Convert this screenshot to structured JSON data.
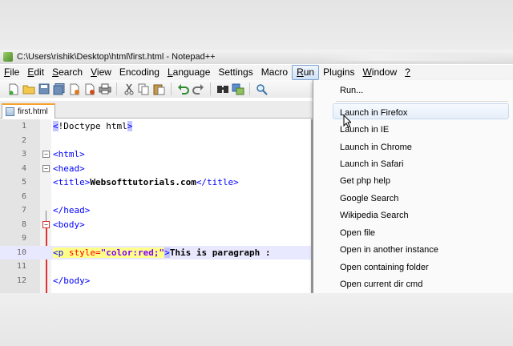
{
  "window": {
    "title": "C:\\Users\\rishik\\Desktop\\html\\first.html - Notepad++"
  },
  "menubar": {
    "items": [
      {
        "label": "File",
        "u": "F",
        "rest": "ile"
      },
      {
        "label": "Edit",
        "u": "E",
        "rest": "dit"
      },
      {
        "label": "Search",
        "u": "S",
        "rest": "earch"
      },
      {
        "label": "View",
        "u": "V",
        "rest": "iew"
      },
      {
        "label": "Encoding",
        "u": "",
        "rest": "Encoding"
      },
      {
        "label": "Language",
        "u": "L",
        "rest": "anguage"
      },
      {
        "label": "Settings",
        "u": "",
        "rest": "Settings"
      },
      {
        "label": "Macro",
        "u": "",
        "rest": "Macro"
      },
      {
        "label": "Run",
        "u": "R",
        "rest": "un"
      },
      {
        "label": "Plugins",
        "u": "",
        "rest": "Plugins"
      },
      {
        "label": "Window",
        "u": "W",
        "rest": "indow"
      },
      {
        "label": "?",
        "u": "?",
        "rest": ""
      }
    ]
  },
  "tabs": [
    {
      "label": "first.html"
    }
  ],
  "editor": {
    "line_numbers": [
      "1",
      "2",
      "3",
      "4",
      "5",
      "6",
      "7",
      "8",
      "9",
      "10",
      "11",
      "12"
    ],
    "lines": [
      {
        "pre": "",
        "t1": "<",
        "mid": "!Doctype html",
        "t2": ">"
      },
      {},
      {
        "t1": "<html>"
      },
      {
        "t1": "<head>"
      },
      {
        "t1": "<title>",
        "text": "Websofttutorials.com",
        "t2": "</title>"
      },
      {},
      {
        "t1": "</head>"
      },
      {
        "t1": "<body>"
      },
      {},
      {
        "t1": "p",
        "attr": " style=",
        "str": "\"color:red;\"",
        "text": "This is paragraph :"
      },
      {},
      {
        "t1": "</body>"
      }
    ]
  },
  "run_menu": {
    "items": [
      "Run...",
      "Launch in Firefox",
      "Launch in IE",
      "Launch in Chrome",
      "Launch in Safari",
      "Get php help",
      "Google Search",
      "Wikipedia Search",
      "Open file",
      "Open in another instance",
      "Open containing folder",
      "Open current dir cmd"
    ]
  },
  "colors": {
    "tag": "#0000ff",
    "attr": "#ff0000",
    "string": "#8000ff",
    "current_line": "#e8e8ff",
    "active_tab_accent": "#f6a12c"
  }
}
